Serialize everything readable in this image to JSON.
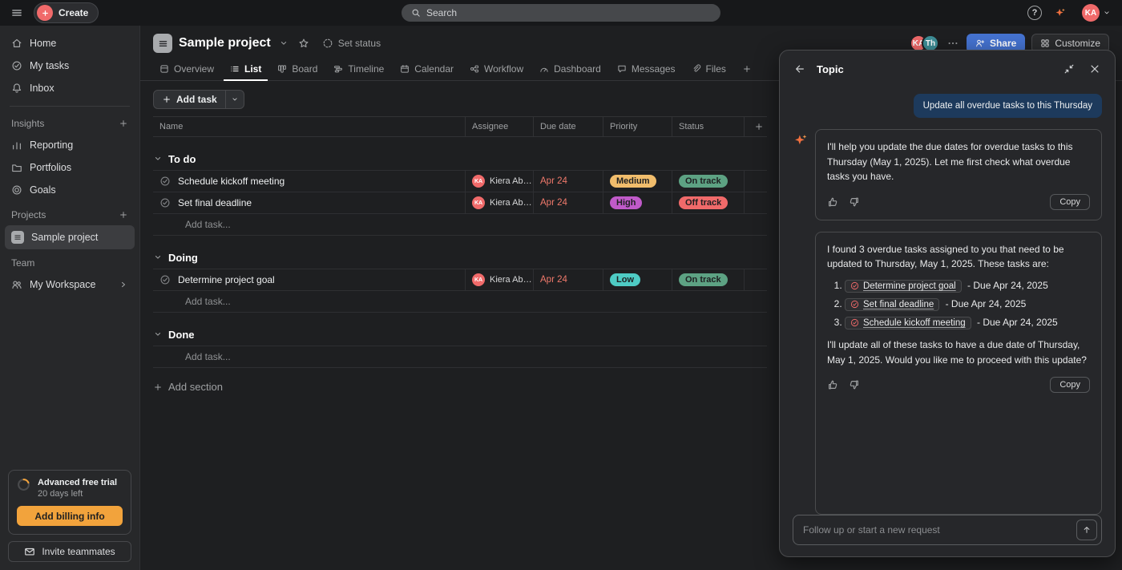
{
  "colors": {
    "accent": "#f06a6a",
    "avatar_ka": "#f06a6a",
    "avatar_th": "#3e8f98",
    "share_button": "#4573d2",
    "billing_button": "#f2a33c",
    "user_bubble": "#1d3a5c",
    "due_overdue": "#f0796b"
  },
  "topbar": {
    "create": "Create",
    "search_placeholder": "Search",
    "help": "?",
    "user_initials": "KA"
  },
  "sidebar": {
    "nav": [
      {
        "label": "Home"
      },
      {
        "label": "My tasks"
      },
      {
        "label": "Inbox"
      }
    ],
    "insights": {
      "header": "Insights",
      "items": [
        {
          "label": "Reporting"
        },
        {
          "label": "Portfolios"
        },
        {
          "label": "Goals"
        }
      ]
    },
    "projects": {
      "header": "Projects",
      "items": [
        {
          "label": "Sample project"
        }
      ]
    },
    "team": {
      "header": "Team",
      "items": [
        {
          "label": "My Workspace"
        }
      ]
    },
    "trial": {
      "title": "Advanced free trial",
      "days_left": "20 days left",
      "billing_button": "Add billing info"
    },
    "invite_button": "Invite teammates"
  },
  "project_header": {
    "title": "Sample project",
    "set_status": "Set status",
    "avatars": [
      {
        "initials": "KA",
        "color": "#f06a6a"
      },
      {
        "initials": "Th",
        "color": "#3e8f98"
      }
    ],
    "share": "Share",
    "customize": "Customize"
  },
  "tabs": {
    "active": "List",
    "items": [
      {
        "label": "Overview"
      },
      {
        "label": "List"
      },
      {
        "label": "Board"
      },
      {
        "label": "Timeline"
      },
      {
        "label": "Calendar"
      },
      {
        "label": "Workflow"
      },
      {
        "label": "Dashboard"
      },
      {
        "label": "Messages"
      },
      {
        "label": "Files"
      }
    ]
  },
  "toolbar": {
    "add_task": "Add task"
  },
  "table": {
    "columns": [
      {
        "label": "Name"
      },
      {
        "label": "Assignee"
      },
      {
        "label": "Due date"
      },
      {
        "label": "Priority"
      },
      {
        "label": "Status"
      }
    ],
    "sections": [
      {
        "title": "To do",
        "add_task": "Add task...",
        "rows": [
          {
            "name": "Schedule kickoff meeting",
            "initials": "KA",
            "assignee": "Kiera Abba...",
            "due": "Apr 24",
            "priority": "Medium",
            "priority_color": "#f1bd6c",
            "status": "On track",
            "status_color": "#5da283"
          },
          {
            "name": "Set final deadline",
            "initials": "KA",
            "assignee": "Kiera Abba...",
            "due": "Apr 24",
            "priority": "High",
            "priority_color": "#c05ac9",
            "status": "Off track",
            "status_color": "#f06a6a"
          }
        ]
      },
      {
        "title": "Doing",
        "add_task": "Add task...",
        "rows": [
          {
            "name": "Determine project goal",
            "initials": "KA",
            "assignee": "Kiera Abba...",
            "due": "Apr 24",
            "priority": "Low",
            "priority_color": "#4ecbc4",
            "status": "On track",
            "status_color": "#5da283"
          }
        ]
      },
      {
        "title": "Done",
        "add_task": "Add task...",
        "rows": []
      }
    ],
    "add_section": "Add section"
  },
  "chat": {
    "title": "Topic",
    "user_message": "Update all overdue tasks to this Thursday",
    "message1": "I'll help you update the due dates for overdue tasks to this Thursday (May 1, 2025). Let me first check what overdue tasks you have.",
    "message2_intro": "I found 3 overdue tasks assigned to you that need to be updated to Thursday, May 1, 2025. These tasks are:",
    "task_refs": [
      {
        "name": "Determine project goal",
        "suffix": "- Due Apr 24, 2025"
      },
      {
        "name": "Set final deadline",
        "suffix": "- Due Apr 24, 2025"
      },
      {
        "name": "Schedule kickoff meeting",
        "suffix": "- Due Apr 24, 2025"
      }
    ],
    "message2_outro": "I'll update all of these tasks to have a due date of Thursday, May 1, 2025. Would you like me to proceed with this update?",
    "copy": "Copy",
    "input_placeholder": "Follow up or start a new request"
  }
}
